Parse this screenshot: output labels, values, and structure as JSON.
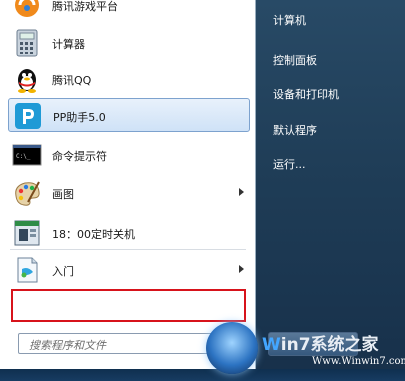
{
  "left_menu": {
    "items": [
      {
        "label": "腾讯游戏平台",
        "icon": "tencent-game-icon",
        "has_submenu": false
      },
      {
        "label": "计算器",
        "icon": "calculator-icon",
        "has_submenu": false
      },
      {
        "label": "腾讯QQ",
        "icon": "qq-penguin-icon",
        "has_submenu": false
      },
      {
        "label": "PP助手5.0",
        "icon": "pp-assistant-icon",
        "has_submenu": false,
        "highlighted": true
      },
      {
        "label": "命令提示符",
        "icon": "command-prompt-icon",
        "has_submenu": false
      },
      {
        "label": "画图",
        "icon": "paint-palette-icon",
        "has_submenu": true
      },
      {
        "label": "18：00定时关机",
        "icon": "shutdown-timer-icon",
        "has_submenu": false
      },
      {
        "label": "入门",
        "icon": "getting-started-icon",
        "has_submenu": true
      }
    ]
  },
  "search": {
    "placeholder": "搜索程序和文件"
  },
  "right_menu": {
    "items": [
      {
        "label": "计算机"
      },
      {
        "label": "控制面板"
      },
      {
        "label": "设备和打印机"
      },
      {
        "label": "默认程序"
      },
      {
        "label": "运行..."
      }
    ]
  },
  "watermark": {
    "brand_w": "W",
    "brand_text": "in7系统之家",
    "url": "Www.Winwin7.com"
  },
  "colors": {
    "highlight_border": "#7da2ce",
    "red_box": "#d7131b",
    "right_pane": "#1f3d57"
  }
}
